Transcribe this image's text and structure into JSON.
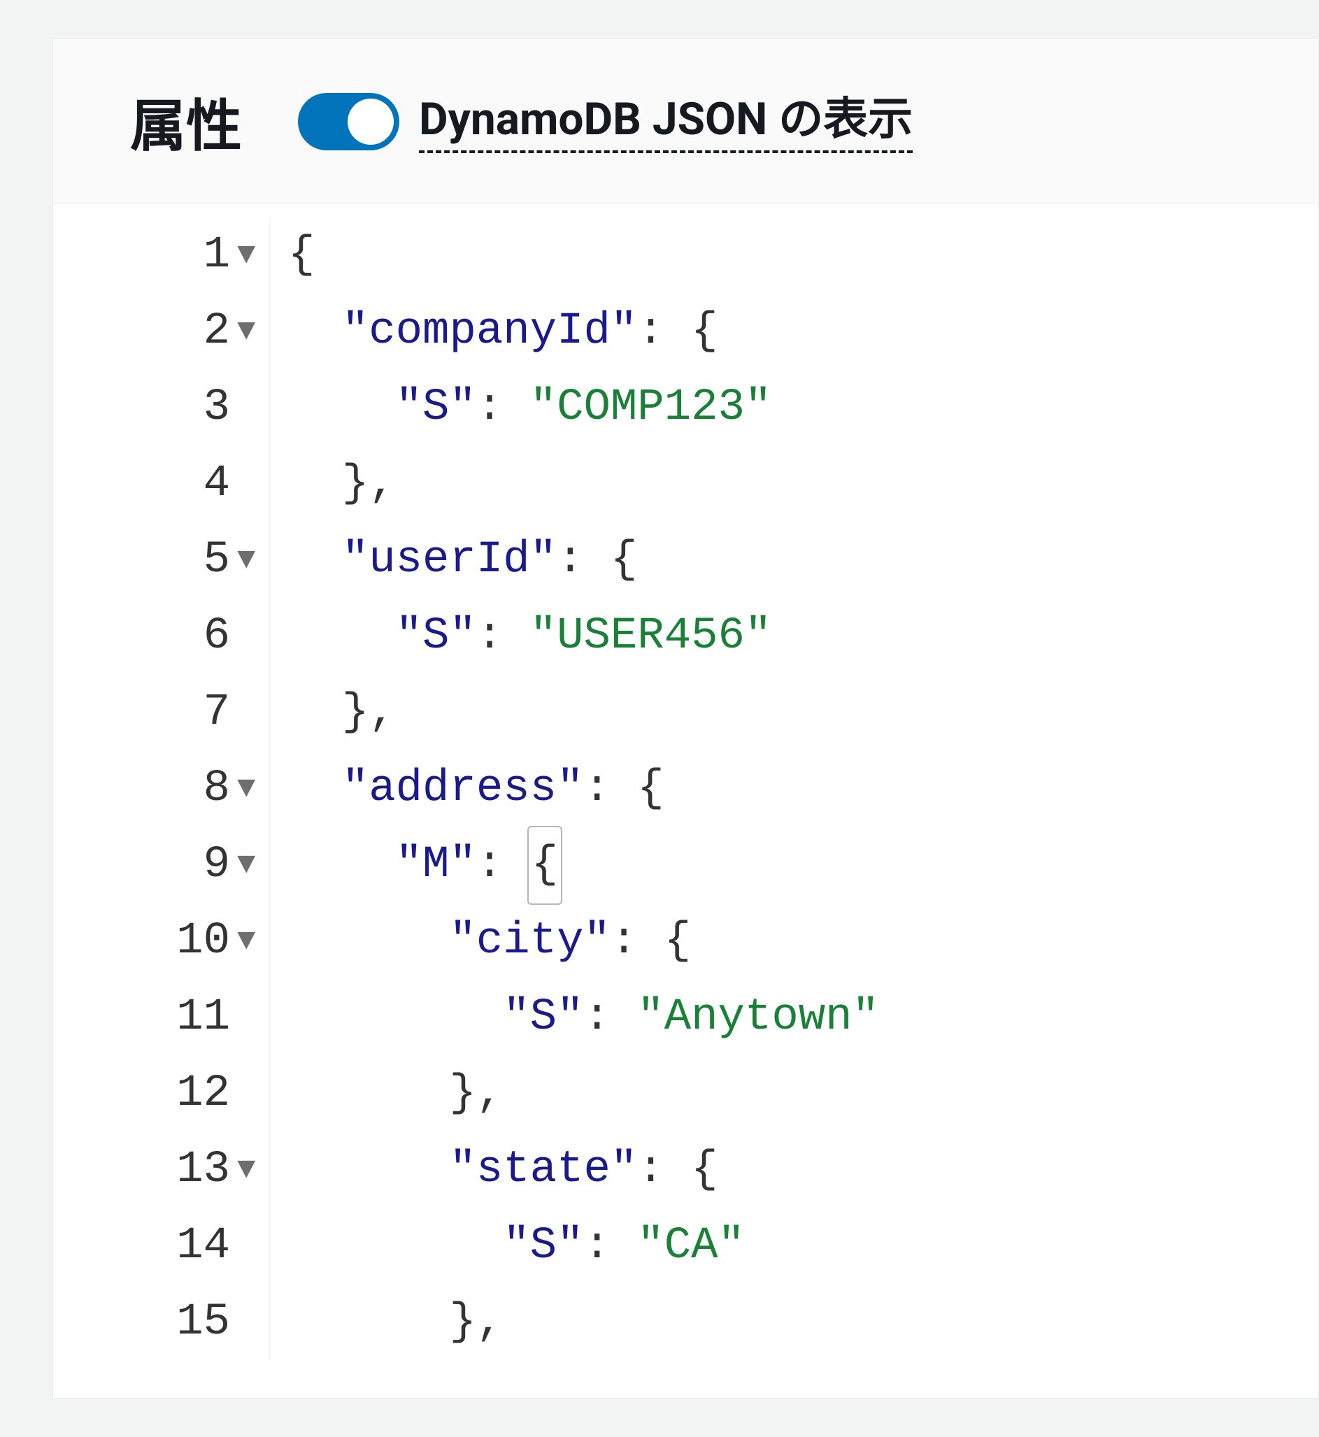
{
  "header": {
    "title": "属性",
    "toggle_label": "DynamoDB JSON の表示",
    "toggle_on": true
  },
  "editor": {
    "lines": [
      {
        "n": 1,
        "foldable": true,
        "indent": 0,
        "tokens": [
          {
            "t": "plain",
            "v": "{"
          }
        ]
      },
      {
        "n": 2,
        "foldable": true,
        "indent": 1,
        "tokens": [
          {
            "t": "key",
            "v": "\"companyId\""
          },
          {
            "t": "plain",
            "v": ": {"
          }
        ]
      },
      {
        "n": 3,
        "foldable": false,
        "indent": 2,
        "tokens": [
          {
            "t": "key",
            "v": "\"S\""
          },
          {
            "t": "plain",
            "v": ": "
          },
          {
            "t": "str",
            "v": "\"COMP123\""
          }
        ]
      },
      {
        "n": 4,
        "foldable": false,
        "indent": 1,
        "tokens": [
          {
            "t": "plain",
            "v": "},"
          }
        ]
      },
      {
        "n": 5,
        "foldable": true,
        "indent": 1,
        "tokens": [
          {
            "t": "key",
            "v": "\"userId\""
          },
          {
            "t": "plain",
            "v": ": {"
          }
        ]
      },
      {
        "n": 6,
        "foldable": false,
        "indent": 2,
        "tokens": [
          {
            "t": "key",
            "v": "\"S\""
          },
          {
            "t": "plain",
            "v": ": "
          },
          {
            "t": "str",
            "v": "\"USER456\""
          }
        ]
      },
      {
        "n": 7,
        "foldable": false,
        "indent": 1,
        "tokens": [
          {
            "t": "plain",
            "v": "},"
          }
        ]
      },
      {
        "n": 8,
        "foldable": true,
        "indent": 1,
        "tokens": [
          {
            "t": "key",
            "v": "\"address\""
          },
          {
            "t": "plain",
            "v": ": {"
          }
        ]
      },
      {
        "n": 9,
        "foldable": true,
        "indent": 2,
        "tokens": [
          {
            "t": "key",
            "v": "\"M\""
          },
          {
            "t": "plain",
            "v": ": "
          },
          {
            "t": "plain",
            "v": "{",
            "hl": true
          }
        ]
      },
      {
        "n": 10,
        "foldable": true,
        "indent": 3,
        "tokens": [
          {
            "t": "key",
            "v": "\"city\""
          },
          {
            "t": "plain",
            "v": ": {"
          }
        ]
      },
      {
        "n": 11,
        "foldable": false,
        "indent": 4,
        "tokens": [
          {
            "t": "key",
            "v": "\"S\""
          },
          {
            "t": "plain",
            "v": ": "
          },
          {
            "t": "str",
            "v": "\"Anytown\""
          }
        ]
      },
      {
        "n": 12,
        "foldable": false,
        "indent": 3,
        "tokens": [
          {
            "t": "plain",
            "v": "},"
          }
        ]
      },
      {
        "n": 13,
        "foldable": true,
        "indent": 3,
        "tokens": [
          {
            "t": "key",
            "v": "\"state\""
          },
          {
            "t": "plain",
            "v": ": {"
          }
        ]
      },
      {
        "n": 14,
        "foldable": false,
        "indent": 4,
        "tokens": [
          {
            "t": "key",
            "v": "\"S\""
          },
          {
            "t": "plain",
            "v": ": "
          },
          {
            "t": "str",
            "v": "\"CA\""
          }
        ]
      },
      {
        "n": 15,
        "foldable": false,
        "indent": 3,
        "tokens": [
          {
            "t": "plain",
            "v": "},"
          }
        ]
      }
    ]
  }
}
